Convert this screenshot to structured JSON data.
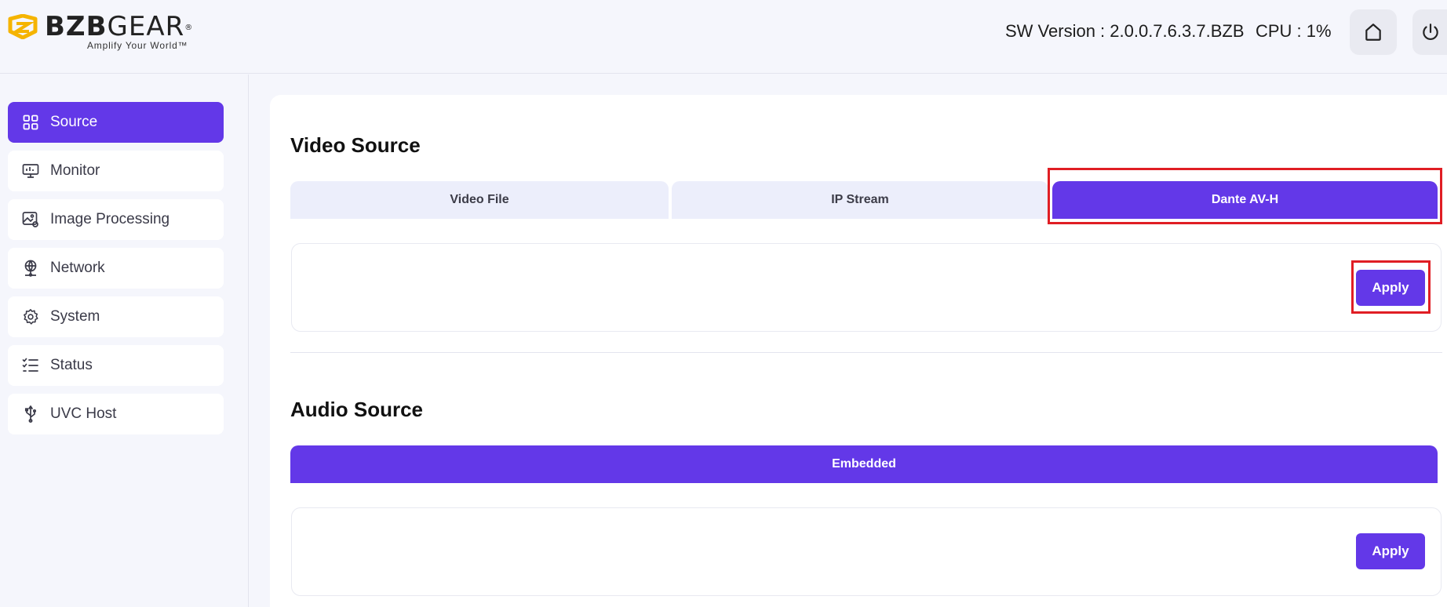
{
  "header": {
    "logo_bold": "BZB",
    "logo_light": "GEAR",
    "logo_reg": "®",
    "logo_tagline": "Amplify Your World™",
    "sw_version": "SW Version : 2.0.0.7.6.3.7.BZB",
    "cpu": "CPU : 1%",
    "icons": {
      "home": "home-icon",
      "power": "power-icon"
    }
  },
  "sidebar": {
    "items": [
      {
        "label": "Source",
        "icon": "grid-icon",
        "active": true
      },
      {
        "label": "Monitor",
        "icon": "monitor-icon",
        "active": false
      },
      {
        "label": "Image Processing",
        "icon": "image-processing-icon",
        "active": false
      },
      {
        "label": "Network",
        "icon": "network-icon",
        "active": false
      },
      {
        "label": "System",
        "icon": "gear-icon",
        "active": false
      },
      {
        "label": "Status",
        "icon": "checklist-icon",
        "active": false
      },
      {
        "label": "UVC Host",
        "icon": "usb-icon",
        "active": false
      }
    ]
  },
  "video_source": {
    "title": "Video Source",
    "tabs": [
      {
        "label": "Video File",
        "active": false
      },
      {
        "label": "IP Stream",
        "active": false
      },
      {
        "label": "Dante AV-H",
        "active": true
      }
    ],
    "apply_label": "Apply"
  },
  "audio_source": {
    "title": "Audio Source",
    "tabs": [
      {
        "label": "Embedded",
        "active": true
      }
    ],
    "apply_label": "Apply"
  },
  "colors": {
    "accent": "#6338e8",
    "highlight": "#e01e24",
    "logo_yellow": "#f5b400"
  }
}
